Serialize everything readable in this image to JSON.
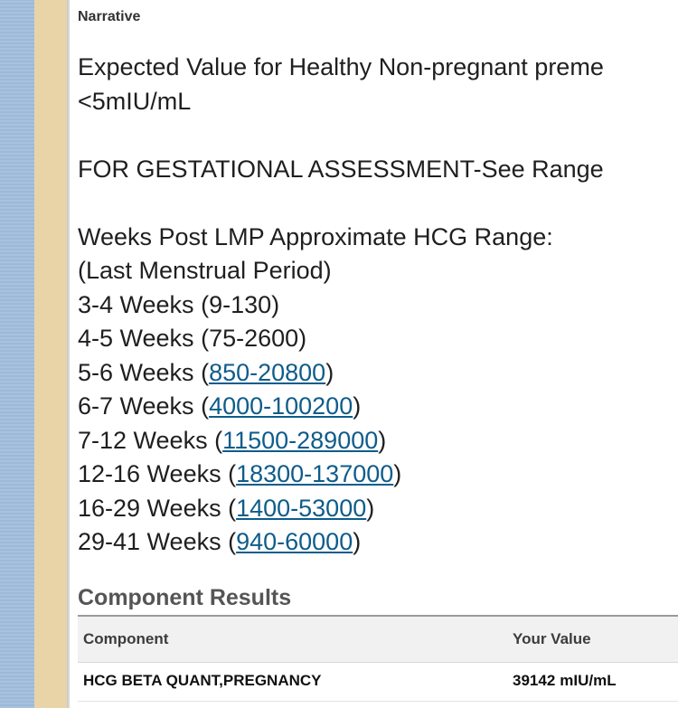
{
  "narrative": {
    "section_label": "Narrative",
    "line1": "Expected Value for Healthy Non-pregnant preme",
    "line2": "<5mIU/mL",
    "line3": "FOR GESTATIONAL ASSESSMENT-See Range",
    "line4": "Weeks Post LMP Approximate HCG Range:",
    "line5": "(Last Menstrual Period)",
    "ranges": [
      {
        "weeks": "3-4 Weeks",
        "range": "9-130",
        "linked": false
      },
      {
        "weeks": "4-5 Weeks",
        "range": "75-2600",
        "linked": false
      },
      {
        "weeks": "5-6 Weeks",
        "range": "850-20800",
        "linked": true
      },
      {
        "weeks": "6-7 Weeks",
        "range": "4000-100200",
        "linked": true
      },
      {
        "weeks": "7-12 Weeks",
        "range": "11500-289000",
        "linked": true
      },
      {
        "weeks": "12-16 Weeks",
        "range": "18300-137000",
        "linked": true
      },
      {
        "weeks": "16-29 Weeks",
        "range": "1400-53000",
        "linked": true
      },
      {
        "weeks": "29-41 Weeks",
        "range": "940-60000",
        "linked": true
      }
    ]
  },
  "component_results": {
    "title": "Component Results",
    "headers": {
      "component": "Component",
      "value": "Your Value"
    },
    "rows": [
      {
        "component": "HCG BETA QUANT,PREGNANCY",
        "value": "39142",
        "unit": "mIU/mL"
      }
    ]
  },
  "colors": {
    "link": "#0e5c8b",
    "sidebar_blue": "#a7c2de",
    "sidebar_tan": "#e8d4a6"
  }
}
